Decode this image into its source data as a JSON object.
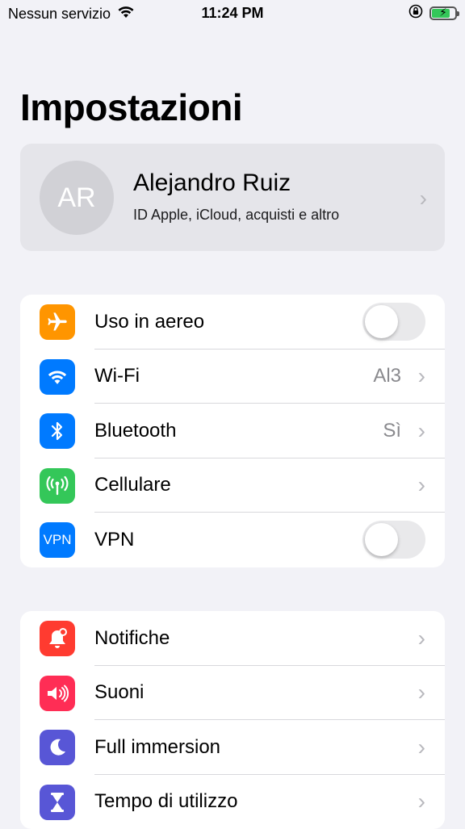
{
  "status_bar": {
    "carrier": "Nessun servizio",
    "time": "11:24 PM",
    "wifi_icon": "wifi-icon",
    "lock_icon": "rotation-lock-icon",
    "battery_icon": "battery-charging-icon",
    "battery_level": 0.8
  },
  "page": {
    "title": "Impostazioni"
  },
  "profile": {
    "initials": "AR",
    "name": "Alejandro Ruiz",
    "subtitle": "ID Apple, iCloud, acquisti e altro"
  },
  "groups": [
    {
      "items": [
        {
          "label": "Uso in aereo",
          "icon": "airplane-icon",
          "color": "#ff9500",
          "control": "toggle",
          "on": false
        },
        {
          "label": "Wi-Fi",
          "icon": "wifi-icon",
          "color": "#007aff",
          "value": "Al3"
        },
        {
          "label": "Bluetooth",
          "icon": "bluetooth-icon",
          "color": "#007aff",
          "value": "Sì"
        },
        {
          "label": "Cellulare",
          "icon": "antenna-icon",
          "color": "#34c759"
        },
        {
          "label": "VPN",
          "icon": "vpn-icon",
          "icon_text": "VPN",
          "color": "#007aff",
          "control": "toggle",
          "on": false
        }
      ]
    },
    {
      "items": [
        {
          "label": "Notifiche",
          "icon": "notification-bell-icon",
          "color": "#ff3b30"
        },
        {
          "label": "Suoni",
          "icon": "speaker-icon",
          "color": "#ff2d55"
        },
        {
          "label": "Full immersion",
          "icon": "moon-icon",
          "color": "#5856d6"
        },
        {
          "label": "Tempo di utilizzo",
          "icon": "hourglass-icon",
          "color": "#5856d6"
        }
      ]
    }
  ]
}
